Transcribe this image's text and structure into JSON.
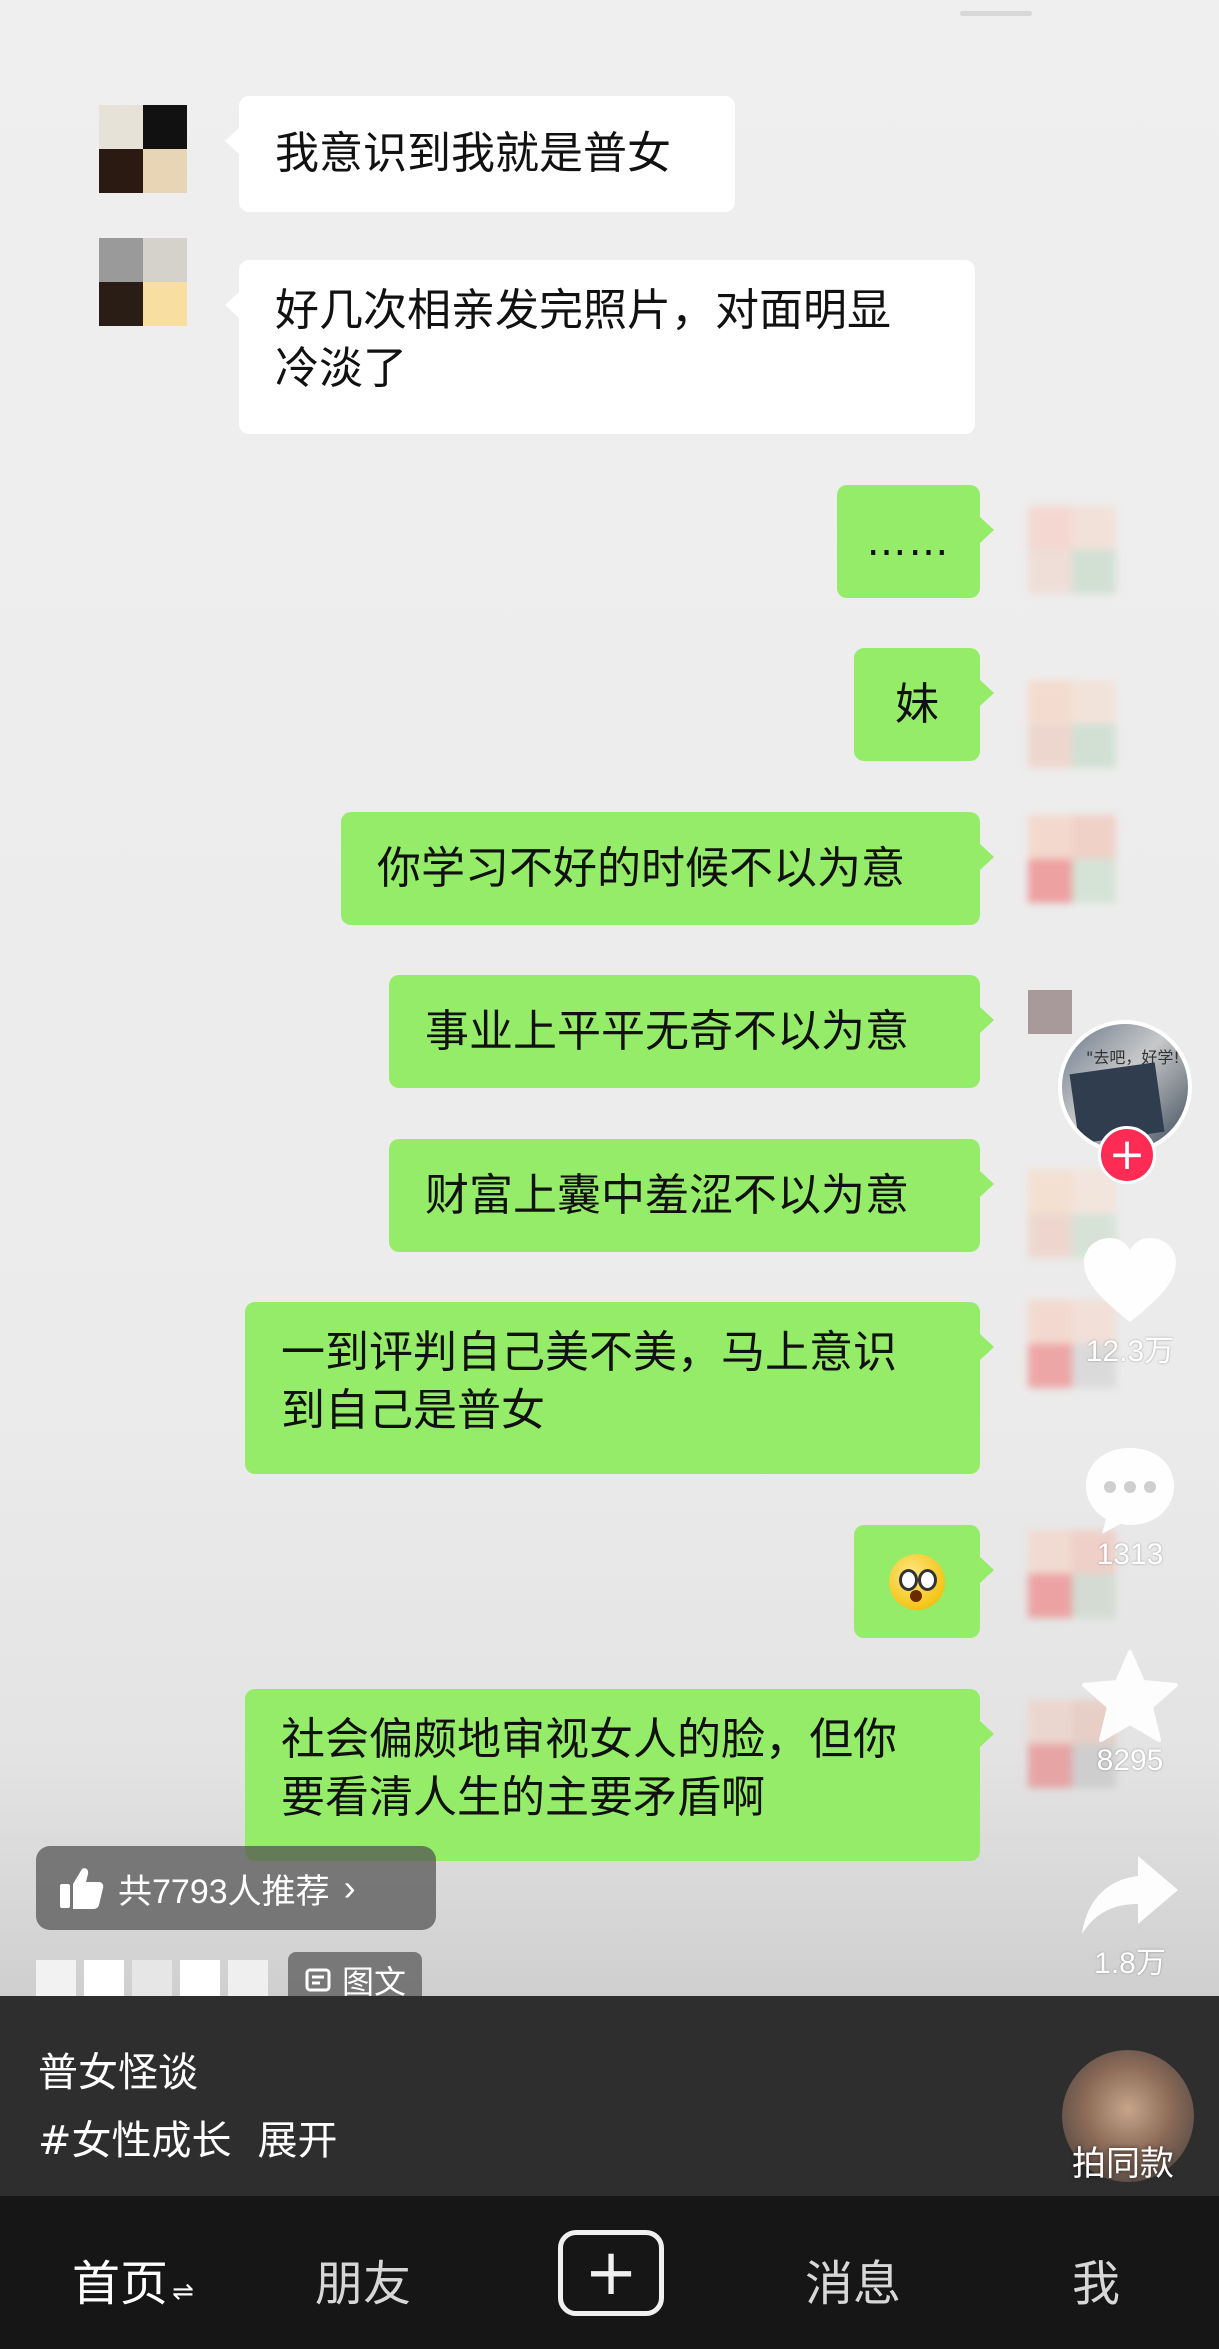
{
  "chat": {
    "left_messages": [
      {
        "text": "我意识到我就是普女"
      },
      {
        "line1": "好几次相亲发完照片，对面明显",
        "line2": "冷淡了"
      }
    ],
    "right_messages": [
      {
        "text": "……"
      },
      {
        "text": "妹"
      },
      {
        "text": "你学习不好的时候不以为意"
      },
      {
        "text": "事业上平平无奇不以为意"
      },
      {
        "text": "财富上囊中羞涩不以为意"
      },
      {
        "line1": "一到评判自己美不美，马上意识",
        "line2": "到自己是普女"
      },
      {
        "emoji": "astonished-emoji"
      },
      {
        "line1": "社会偏颇地审视女人的脸，但你",
        "line2": "要看清人生的主要矛盾啊"
      }
    ]
  },
  "rail": {
    "author_avatar_text": "\"去吧，好学!\"",
    "follow_icon": "plus-icon",
    "like_count": "12.3万",
    "comment_count": "1313",
    "favorite_count": "8295",
    "share_count": "1.8万"
  },
  "recommend": {
    "label": "共7793人推荐",
    "chevron": "›"
  },
  "post": {
    "type_label": "图文",
    "title": "普女怪谈",
    "hashtag": "#女性成长",
    "expand": "展开",
    "music_label": "拍同款"
  },
  "nav": {
    "home": "首页",
    "home_switch": "⇌",
    "friends": "朋友",
    "create": "+",
    "messages": "消息",
    "me": "我"
  },
  "colors": {
    "bubble_right": "#95ec69",
    "bubble_left": "#ffffff",
    "follow_red": "#fe2c55",
    "nav_bg": "#161616"
  }
}
